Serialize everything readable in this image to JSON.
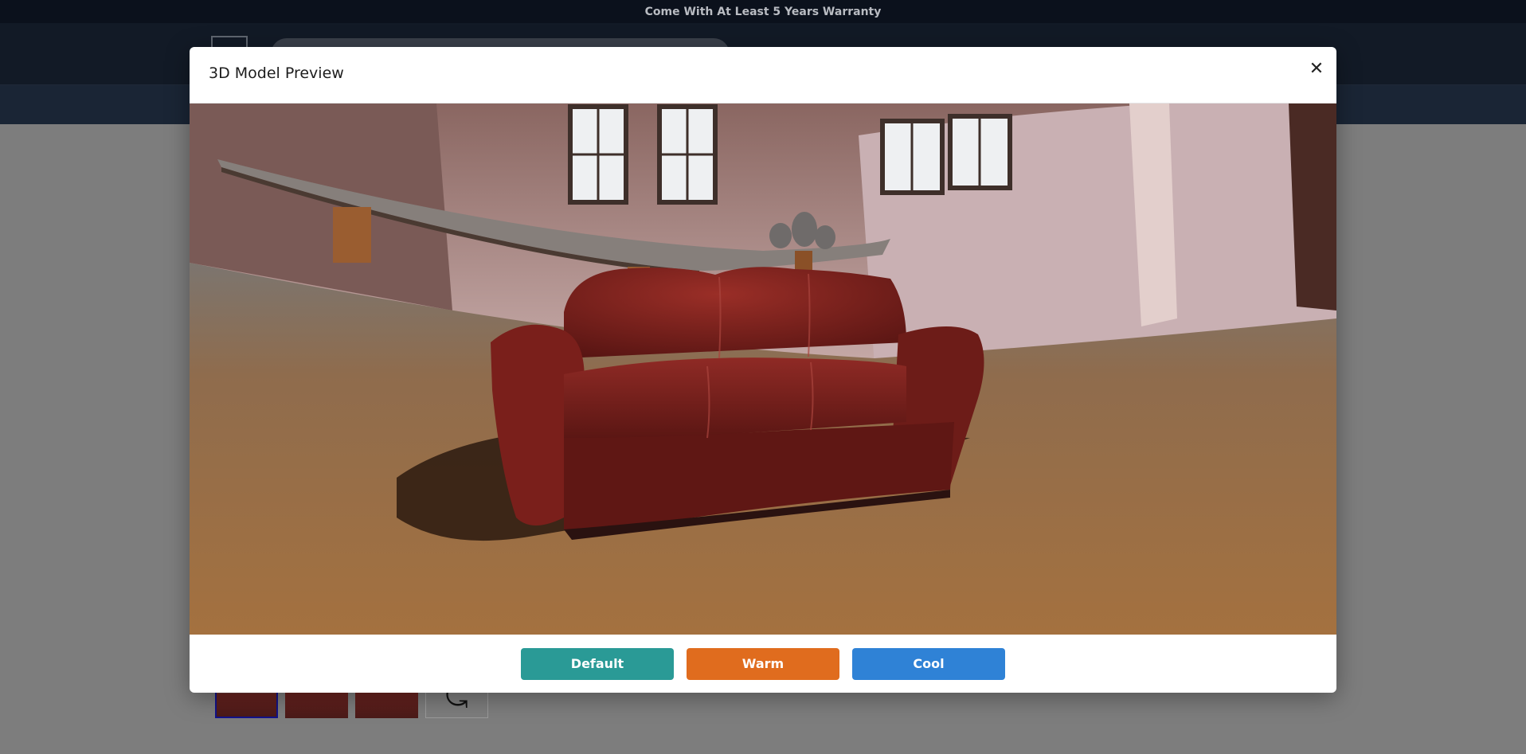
{
  "announcement": "Come With At Least 5 Years Warranty",
  "modal": {
    "title": "3D Model Preview",
    "close_icon": "close-icon",
    "buttons": {
      "default_label": "Default",
      "warm_label": "Warm",
      "cool_label": "Cool"
    },
    "button_colors": {
      "default": "#2a9a96",
      "warm": "#e06c1e",
      "cool": "#2f82d6"
    }
  },
  "viewer": {
    "subject": "red leather three-seat sofa",
    "environment": "room with long table, vases and windows"
  },
  "background_page": {
    "thumbnails_icons": [
      "sofa-thumbnail",
      "sofa-thumbnail",
      "sofa-thumbnail",
      "rotate-360-icon"
    ]
  }
}
